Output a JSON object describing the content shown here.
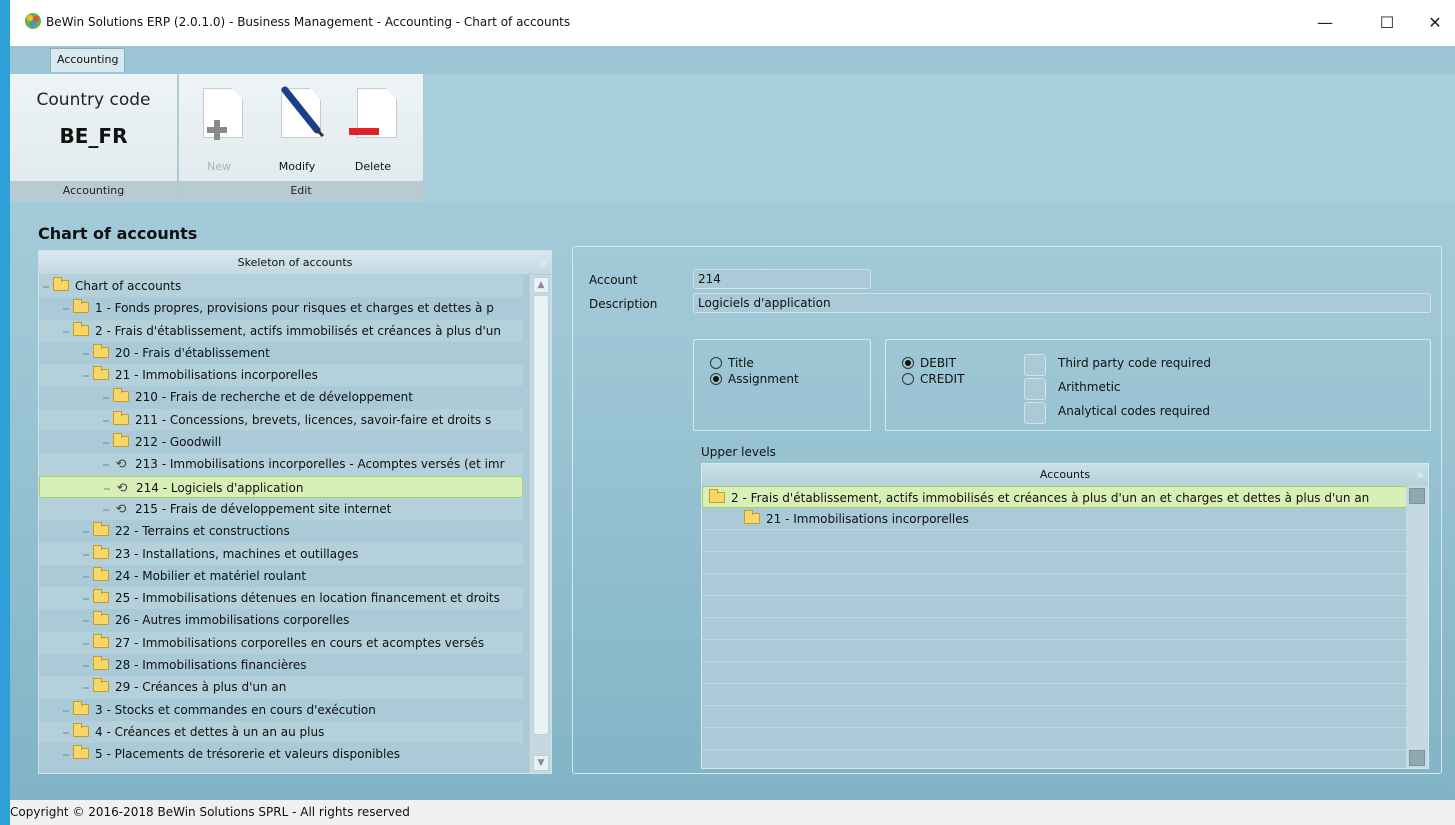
{
  "window": {
    "title": "BeWin Solutions ERP (2.0.1.0)  - Business Management - Accounting - Chart of accounts",
    "minimize": "—",
    "maximize": "☐",
    "close": "✕"
  },
  "tabs": [
    {
      "label": "Accounting"
    }
  ],
  "ribbon": {
    "country_label": "Country code",
    "country_value": "BE_FR",
    "group_accounting": "Accounting",
    "group_edit": "Edit",
    "new_label": "New",
    "modify_label": "Modify",
    "delete_label": "Delete"
  },
  "page_title": "Chart of accounts",
  "tree": {
    "header": "Skeleton of accounts",
    "rows": [
      {
        "text": "Chart of accounts",
        "level": 0,
        "type": "folder"
      },
      {
        "text": "1 - Fonds propres, provisions pour risques et charges et dettes à p",
        "level": 1,
        "type": "folder"
      },
      {
        "text": "2 - Frais d'établissement, actifs immobilisés et créances à plus d'un",
        "level": 1,
        "type": "folder"
      },
      {
        "text": "20 - Frais d'établissement",
        "level": 2,
        "type": "folder"
      },
      {
        "text": "21 - Immobilisations incorporelles",
        "level": 2,
        "type": "folder"
      },
      {
        "text": "210 - Frais de recherche et de développement",
        "level": 3,
        "type": "folder"
      },
      {
        "text": "211 - Concessions, brevets, licences, savoir-faire et droits s",
        "level": 3,
        "type": "folder"
      },
      {
        "text": "212 - Goodwill",
        "level": 3,
        "type": "folder"
      },
      {
        "text": "213 - Immobilisations incorporelles - Acomptes versés (et imr",
        "level": 3,
        "type": "leaf"
      },
      {
        "text": "214 - Logiciels d'application",
        "level": 3,
        "type": "leaf",
        "selected": true
      },
      {
        "text": "215 - Frais de développement site internet",
        "level": 3,
        "type": "leaf"
      },
      {
        "text": "22 - Terrains et constructions",
        "level": 2,
        "type": "folder"
      },
      {
        "text": "23 - Installations, machines et outillages",
        "level": 2,
        "type": "folder"
      },
      {
        "text": "24 - Mobilier et matériel roulant",
        "level": 2,
        "type": "folder"
      },
      {
        "text": "25 - Immobilisations détenues en location financement et droits",
        "level": 2,
        "type": "folder"
      },
      {
        "text": "26 - Autres immobilisations corporelles",
        "level": 2,
        "type": "folder"
      },
      {
        "text": "27 - Immobilisations corporelles en cours et acomptes versés",
        "level": 2,
        "type": "folder"
      },
      {
        "text": "28 - Immobilisations financières",
        "level": 2,
        "type": "folder"
      },
      {
        "text": "29 - Créances à plus d'un an",
        "level": 2,
        "type": "folder"
      },
      {
        "text": "3 - Stocks et commandes en cours d'exécution",
        "level": 1,
        "type": "folder"
      },
      {
        "text": "4 - Créances et dettes à un an au plus",
        "level": 1,
        "type": "folder"
      },
      {
        "text": "5 - Placements de trésorerie et valeurs disponibles",
        "level": 1,
        "type": "folder"
      }
    ]
  },
  "detail": {
    "account_label": "Account",
    "account_value": "214",
    "description_label": "Description",
    "description_value": "Logiciels d'application",
    "type_title": "Title",
    "type_assignment": "Assignment",
    "debit": "DEBIT",
    "credit": "CREDIT",
    "third_party": "Third party code required",
    "arithmetic": "Arithmetic",
    "analytical": "Analytical codes required",
    "upper_levels_label": "Upper levels",
    "upper_header": "Accounts",
    "upper_rows": [
      {
        "text": "2 - Frais d'établissement, actifs immobilisés et créances à plus d'un an et charges et dettes à plus d'un an",
        "level": 0,
        "selected": true
      },
      {
        "text": "21 - Immobilisations incorporelles",
        "level": 1
      }
    ]
  },
  "status": {
    "copyright": "Copyright © 2016-2018 BeWin Solutions SPRL - All rights reserved"
  },
  "colors": {
    "selection_fill": "#d8f0b8",
    "selection_border": "#a5cf66",
    "panel_bg": "#a9cad6",
    "delete_red": "#e0222a",
    "new_gray": "#8a8a8a"
  }
}
